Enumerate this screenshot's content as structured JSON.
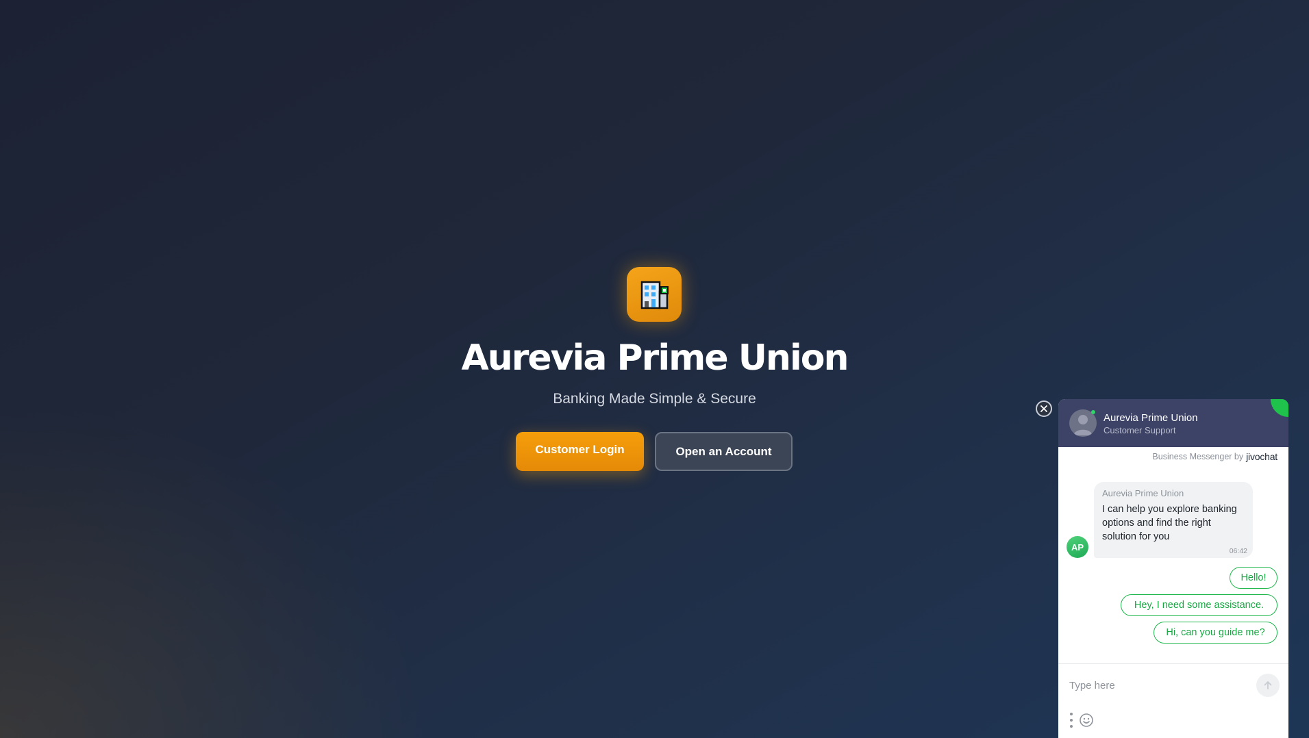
{
  "hero": {
    "logo_icon": "office-building-icon",
    "title": "Aurevia Prime Union",
    "tagline": "Banking Made Simple & Secure",
    "login_label": "Customer Login",
    "open_account_label": "Open an Account"
  },
  "colors": {
    "accent": "#f59e0b",
    "chat_header": "#3d4366",
    "chat_green": "#1fb84d"
  },
  "chat": {
    "header": {
      "name": "Aurevia Prime Union",
      "role": "Customer Support"
    },
    "powered_prefix": "Business Messenger by",
    "powered_brand": "jivochat",
    "agent_initials": "AP",
    "message": {
      "sender": "Aurevia Prime Union",
      "text": "I can help you explore banking options and find the right solution for you",
      "time": "06:42"
    },
    "quick_replies": [
      "Hello!",
      "Hey, I need some assistance.",
      "Hi, can you guide me?"
    ],
    "input_placeholder": "Type here"
  }
}
